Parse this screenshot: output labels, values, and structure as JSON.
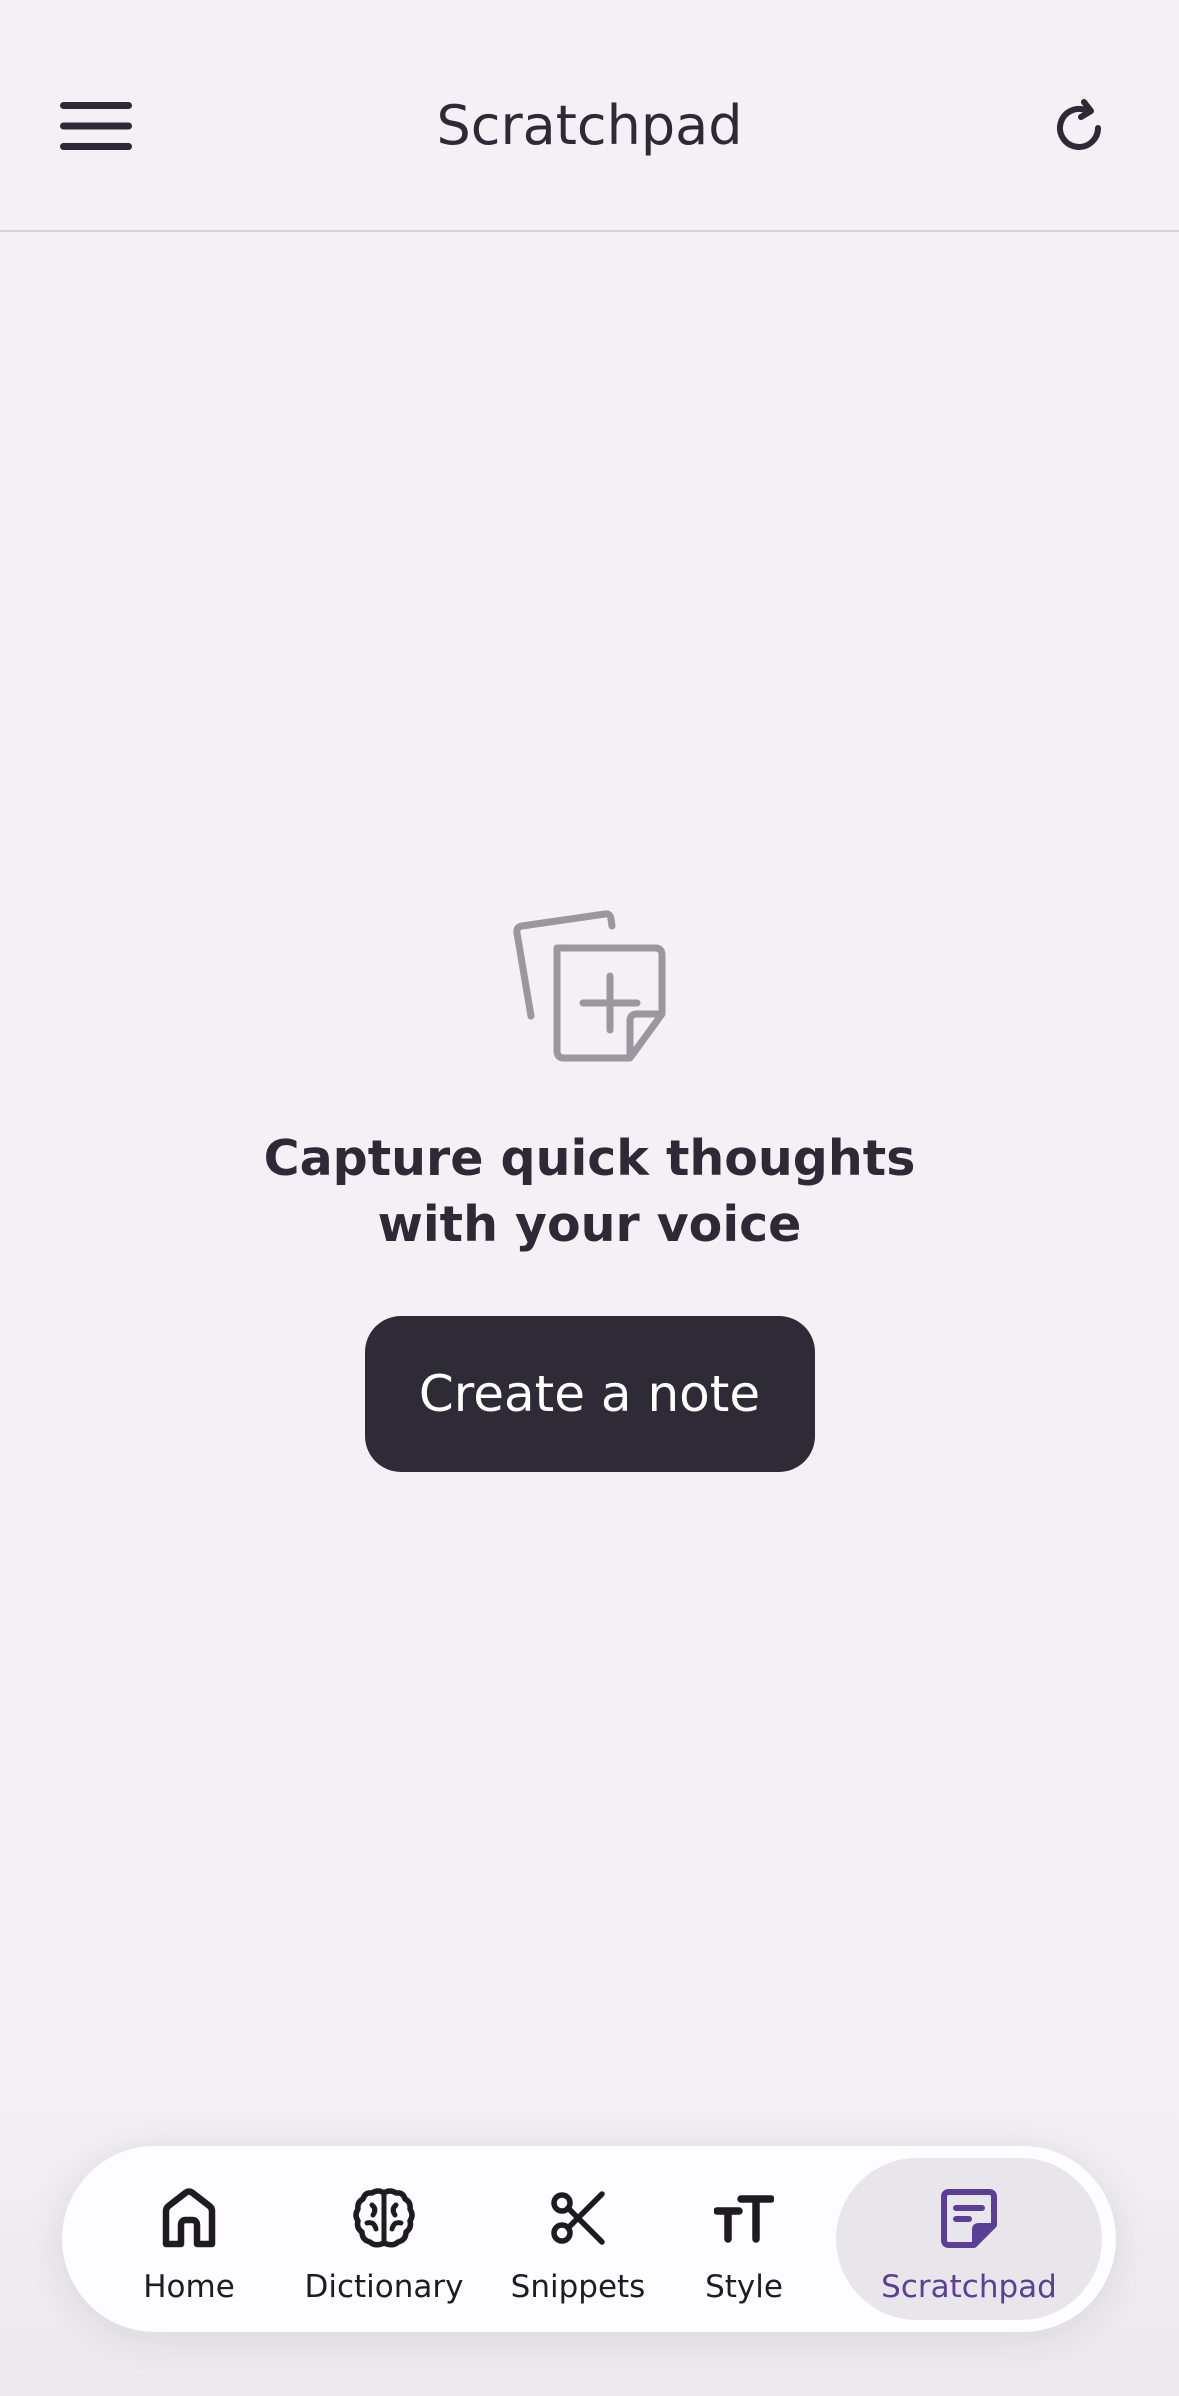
{
  "header": {
    "title": "Scratchpad",
    "menu_icon": "hamburger-menu-icon",
    "refresh_icon": "refresh-icon"
  },
  "empty_state": {
    "illustration_icon": "add-note-icon",
    "heading": "Capture quick thoughts with your voice",
    "cta_label": "Create a note"
  },
  "bottom_nav": {
    "items": [
      {
        "label": "Home",
        "icon": "home-icon",
        "active": false
      },
      {
        "label": "Dictionary",
        "icon": "brain-icon",
        "active": false
      },
      {
        "label": "Snippets",
        "icon": "scissors-icon",
        "active": false
      },
      {
        "label": "Style",
        "icon": "text-size-icon",
        "active": false
      },
      {
        "label": "Scratchpad",
        "icon": "note-icon",
        "active": true
      }
    ]
  },
  "colors": {
    "background": "#f3f1f5",
    "text": "#2d2a35",
    "button": "#2e2b37",
    "active_accent": "#5b3f96",
    "illustration": "#9a989e"
  }
}
